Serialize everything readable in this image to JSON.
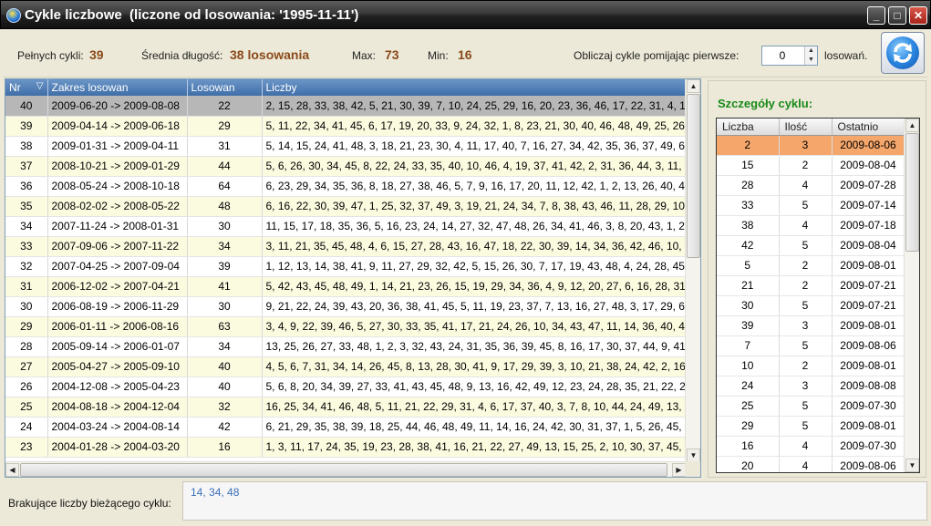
{
  "window": {
    "title": "Cykle liczbowe  (liczone od losowania: '1995-11-11')",
    "minimize": "_",
    "maximize": "□",
    "close": "✕"
  },
  "stats": {
    "full_cycles_label": "Pełnych cykli:",
    "full_cycles_value": "39",
    "avg_length_label": "Średnia długość:",
    "avg_length_value": "38 losowania",
    "max_label": "Max:",
    "max_value": "73",
    "min_label": "Min:",
    "min_value": "16",
    "skip_label": "Obliczaj cykle pomijając pierwsze:",
    "skip_value": "0",
    "skip_suffix": "losowań.",
    "refresh_icon": "refresh-icon"
  },
  "grid": {
    "columns": [
      "Nr",
      "Zakres losowan",
      "Losowan",
      "Liczby"
    ],
    "sort_indicator": "▽",
    "rows": [
      {
        "nr": "40",
        "range": "2009-06-20 -> 2009-08-08",
        "count": "22",
        "numbers": "2, 15, 28, 33, 38, 42, 5, 21, 30, 39, 7, 10, 24, 25, 29, 16, 20, 23, 36, 46, 17, 22, 31, 4, 1"
      },
      {
        "nr": "39",
        "range": "2009-04-14 -> 2009-06-18",
        "count": "29",
        "numbers": "5, 11, 22, 34, 41, 45, 6, 17, 19, 20, 33, 9, 24, 32, 1, 8, 23, 21, 30, 40, 46, 48, 49, 25, 26,"
      },
      {
        "nr": "38",
        "range": "2009-01-31 -> 2009-04-11",
        "count": "31",
        "numbers": "5, 14, 15, 24, 41, 48, 3, 18, 21, 23, 30, 4, 11, 17, 40, 7, 16, 27, 34, 42, 35, 36, 37, 49, 6,"
      },
      {
        "nr": "37",
        "range": "2008-10-21 -> 2009-01-29",
        "count": "44",
        "numbers": "5, 6, 26, 30, 34, 45, 8, 22, 24, 33, 35, 40, 10, 46, 4, 19, 37, 41, 42, 2, 31, 36, 44, 3, 11, 1"
      },
      {
        "nr": "36",
        "range": "2008-05-24 -> 2008-10-18",
        "count": "64",
        "numbers": "6, 23, 29, 34, 35, 36, 8, 18, 27, 38, 46, 5, 7, 9, 16, 17, 20, 11, 12, 42, 1, 2, 13, 26, 40, 43"
      },
      {
        "nr": "35",
        "range": "2008-02-02 -> 2008-05-22",
        "count": "48",
        "numbers": "6, 16, 22, 30, 39, 47, 1, 25, 32, 37, 49, 3, 19, 21, 24, 34, 7, 8, 38, 43, 46, 11, 28, 29, 10,"
      },
      {
        "nr": "34",
        "range": "2007-11-24 -> 2008-01-31",
        "count": "30",
        "numbers": "11, 15, 17, 18, 35, 36, 5, 16, 23, 24, 14, 27, 32, 47, 48, 26, 34, 41, 46, 3, 8, 20, 43, 1, 28"
      },
      {
        "nr": "33",
        "range": "2007-09-06 -> 2007-11-22",
        "count": "34",
        "numbers": "3, 11, 21, 35, 45, 48, 4, 6, 15, 27, 28, 43, 16, 47, 18, 22, 30, 39, 14, 34, 36, 42, 46, 10, 2"
      },
      {
        "nr": "32",
        "range": "2007-04-25 -> 2007-09-04",
        "count": "39",
        "numbers": "1, 12, 13, 14, 38, 41, 9, 11, 27, 29, 32, 42, 5, 15, 26, 30, 7, 17, 19, 43, 48, 4, 24, 28, 45,"
      },
      {
        "nr": "31",
        "range": "2006-12-02 -> 2007-04-21",
        "count": "41",
        "numbers": "5, 42, 43, 45, 48, 49, 1, 14, 21, 23, 26, 15, 19, 29, 34, 36, 4, 9, 12, 20, 27, 6, 16, 28, 31,"
      },
      {
        "nr": "30",
        "range": "2006-08-19 -> 2006-11-29",
        "count": "30",
        "numbers": "9, 21, 22, 24, 39, 43, 20, 36, 38, 41, 45, 5, 11, 19, 23, 37, 7, 13, 16, 27, 48, 3, 17, 29, 6,"
      },
      {
        "nr": "29",
        "range": "2006-01-11 -> 2006-08-16",
        "count": "63",
        "numbers": "3, 4, 9, 22, 39, 46, 5, 27, 30, 33, 35, 41, 17, 21, 24, 26, 10, 34, 43, 47, 11, 14, 36, 40, 45"
      },
      {
        "nr": "28",
        "range": "2005-09-14 -> 2006-01-07",
        "count": "34",
        "numbers": "13, 25, 26, 27, 33, 48, 1, 2, 3, 32, 43, 24, 31, 35, 36, 39, 45, 8, 16, 17, 30, 37, 44, 9, 41,"
      },
      {
        "nr": "27",
        "range": "2005-04-27 -> 2005-09-10",
        "count": "40",
        "numbers": "4, 5, 6, 7, 31, 34, 14, 26, 45, 8, 13, 28, 30, 41, 9, 17, 29, 39, 3, 10, 21, 38, 24, 42, 2, 16,"
      },
      {
        "nr": "26",
        "range": "2004-12-08 -> 2005-04-23",
        "count": "40",
        "numbers": "5, 6, 8, 20, 34, 39, 27, 33, 41, 43, 45, 48, 9, 13, 16, 42, 49, 12, 23, 24, 28, 35, 21, 22, 25"
      },
      {
        "nr": "25",
        "range": "2004-08-18 -> 2004-12-04",
        "count": "32",
        "numbers": "16, 25, 34, 41, 46, 48, 5, 11, 21, 22, 29, 31, 4, 6, 17, 37, 40, 3, 7, 8, 10, 44, 24, 49, 13, 2"
      },
      {
        "nr": "24",
        "range": "2004-03-24 -> 2004-08-14",
        "count": "42",
        "numbers": "6, 21, 29, 35, 38, 39, 18, 25, 44, 46, 48, 49, 11, 14, 16, 24, 42, 30, 31, 37, 1, 5, 26, 45, 3"
      },
      {
        "nr": "23",
        "range": "2004-01-28 -> 2004-03-20",
        "count": "16",
        "numbers": "1, 3, 11, 17, 24, 35, 19, 23, 28, 38, 41, 16, 21, 22, 27, 49, 13, 15, 25, 2, 10, 30, 37, 45, 6"
      }
    ]
  },
  "detail": {
    "title": "Szczegóły cyklu:",
    "columns": [
      "Liczba",
      "Ilość",
      "Ostatnio"
    ],
    "rows": [
      {
        "n": "2",
        "c": "3",
        "d": "2009-08-06"
      },
      {
        "n": "15",
        "c": "2",
        "d": "2009-08-04"
      },
      {
        "n": "28",
        "c": "4",
        "d": "2009-07-28"
      },
      {
        "n": "33",
        "c": "5",
        "d": "2009-07-14"
      },
      {
        "n": "38",
        "c": "4",
        "d": "2009-07-18"
      },
      {
        "n": "42",
        "c": "5",
        "d": "2009-08-04"
      },
      {
        "n": "5",
        "c": "2",
        "d": "2009-08-01"
      },
      {
        "n": "21",
        "c": "2",
        "d": "2009-07-21"
      },
      {
        "n": "30",
        "c": "5",
        "d": "2009-07-21"
      },
      {
        "n": "39",
        "c": "3",
        "d": "2009-08-01"
      },
      {
        "n": "7",
        "c": "5",
        "d": "2009-08-06"
      },
      {
        "n": "10",
        "c": "2",
        "d": "2009-08-01"
      },
      {
        "n": "24",
        "c": "3",
        "d": "2009-08-08"
      },
      {
        "n": "25",
        "c": "5",
        "d": "2009-07-30"
      },
      {
        "n": "29",
        "c": "5",
        "d": "2009-08-01"
      },
      {
        "n": "16",
        "c": "4",
        "d": "2009-07-30"
      },
      {
        "n": "20",
        "c": "4",
        "d": "2009-08-06"
      }
    ]
  },
  "bottom": {
    "missing_label": "Brakujące liczby bieżącego cyklu:",
    "missing_value": "14, 34, 48"
  },
  "colors": {
    "title_gradient": "#222222",
    "stat_value": "#8b4a1a",
    "grid_header": "#4f7fb8",
    "row_alt": "#fbfbe0",
    "row_selected": "#b7b7b7",
    "detail_title": "#1a8a1a",
    "detail_selected": "#f4a66b",
    "missing_value": "#3c6fb8"
  }
}
